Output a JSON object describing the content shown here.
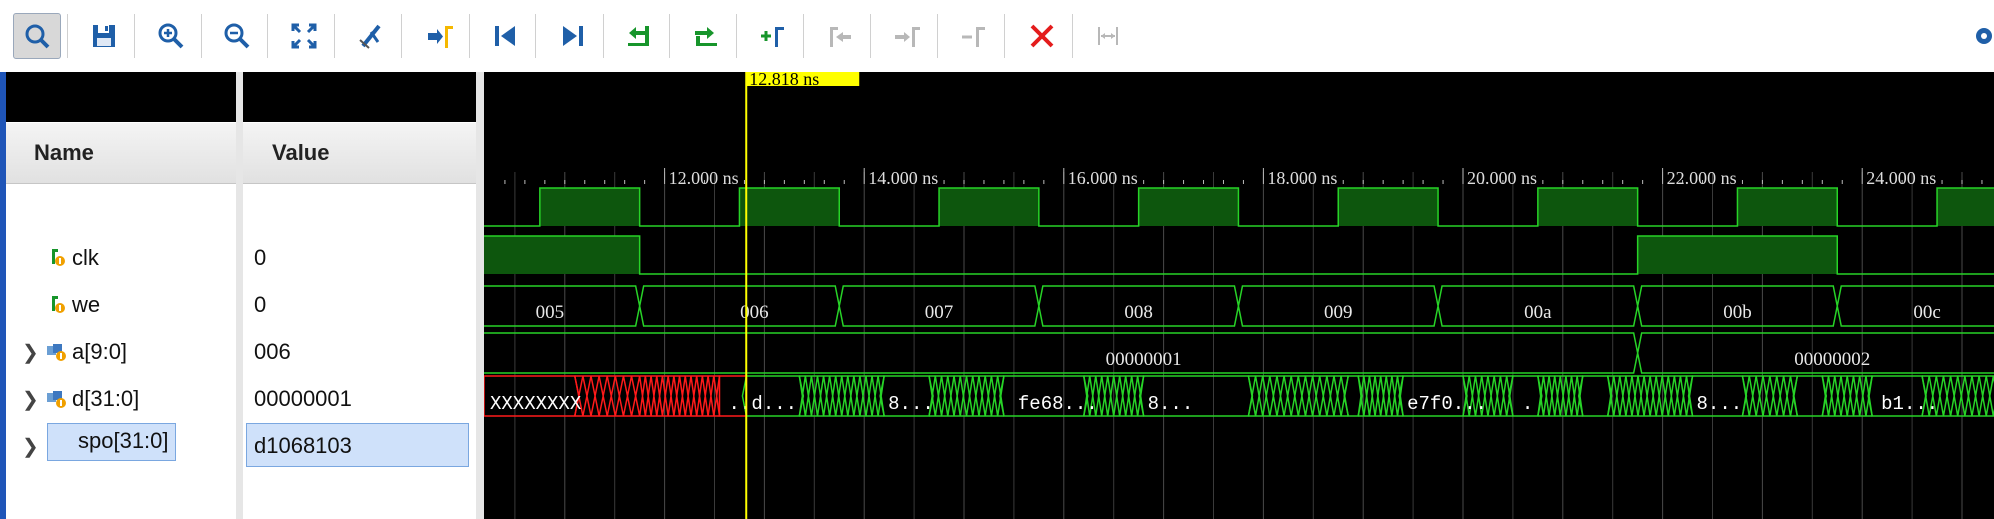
{
  "toolbar": {
    "buttons": [
      {
        "name": "search-button",
        "icon": "search-icon",
        "active": true
      },
      {
        "name": "save-button",
        "icon": "save-icon"
      },
      {
        "name": "zoom-in-button",
        "icon": "zoom-in-icon"
      },
      {
        "name": "zoom-out-button",
        "icon": "zoom-out-icon"
      },
      {
        "name": "zoom-fit-button",
        "icon": "zoom-fit-icon"
      },
      {
        "name": "zoom-to-cursor-button",
        "icon": "cursor-zoom-icon"
      },
      {
        "name": "go-to-cursor-button",
        "icon": "go-to-cursor-icon"
      },
      {
        "name": "go-to-start-button",
        "icon": "go-to-start-icon"
      },
      {
        "name": "go-to-end-button",
        "icon": "go-to-end-icon"
      },
      {
        "name": "previous-transition-button",
        "icon": "previous-transition-icon"
      },
      {
        "name": "next-transition-button",
        "icon": "next-transition-icon"
      },
      {
        "name": "add-marker-button",
        "icon": "add-marker-icon"
      },
      {
        "name": "previous-marker-button",
        "icon": "previous-marker-icon",
        "disabled": true
      },
      {
        "name": "next-marker-button",
        "icon": "next-marker-icon",
        "disabled": true
      },
      {
        "name": "delete-marker-button",
        "icon": "delete-marker-icon",
        "disabled": true
      },
      {
        "name": "delete-all-markers-button",
        "icon": "delete-all-markers-icon"
      },
      {
        "name": "swap-cursors-button",
        "icon": "swap-cursors-icon",
        "disabled": true
      }
    ],
    "settings_icon": "gear-icon"
  },
  "columns": {
    "name": "Name",
    "value": "Value"
  },
  "signals": [
    {
      "name": "clk",
      "value": "0",
      "expandable": false,
      "icon": "bit-signal-icon"
    },
    {
      "name": "we",
      "value": "0",
      "expandable": false,
      "icon": "bit-signal-icon"
    },
    {
      "name": "a[9:0]",
      "value": "006",
      "expandable": true,
      "icon": "bus-signal-icon"
    },
    {
      "name": "d[31:0]",
      "value": "00000001",
      "expandable": true,
      "icon": "bus-signal-icon"
    },
    {
      "name": "spo[31:0]",
      "value": "d1068103",
      "expandable": true,
      "icon": "bus-probe-icon",
      "selected": true
    }
  ],
  "cursor": {
    "label": "12.818 ns",
    "time_ns": 12.818
  },
  "timeline": {
    "ticks": [
      {
        "ns": 12,
        "label": "12.000 ns"
      },
      {
        "ns": 14,
        "label": "14.000 ns"
      },
      {
        "ns": 16,
        "label": "16.000 ns"
      },
      {
        "ns": 18,
        "label": "18.000 ns"
      },
      {
        "ns": 20,
        "label": "20.000 ns"
      },
      {
        "ns": 22,
        "label": "22.000 ns"
      },
      {
        "ns": 24,
        "label": "24.000 ns"
      }
    ]
  },
  "waves": {
    "a_segments": [
      {
        "label": "005"
      },
      {
        "label": "006"
      },
      {
        "label": "007"
      },
      {
        "label": "008"
      },
      {
        "label": "009"
      },
      {
        "label": "00a"
      },
      {
        "label": "00b"
      },
      {
        "label": "00c"
      }
    ],
    "d_segments": [
      {
        "label": "00000001"
      },
      {
        "label": "00000002"
      }
    ],
    "spo_labels": [
      {
        "label": "XXXXXXXX"
      },
      {
        "label": ".."
      },
      {
        "label": "d..."
      },
      {
        "label": "8..."
      },
      {
        "label": "fe68..."
      },
      {
        "label": "8..."
      },
      {
        "label": "e7f0..."
      },
      {
        "label": "."
      },
      {
        "label": "8..."
      },
      {
        "label": "b1..."
      }
    ]
  },
  "colors": {
    "wave": "#27d327",
    "fill": "#0d560d",
    "unknown": "#ff1a1a",
    "cursor": "#ffff00",
    "bg": "#000000"
  }
}
